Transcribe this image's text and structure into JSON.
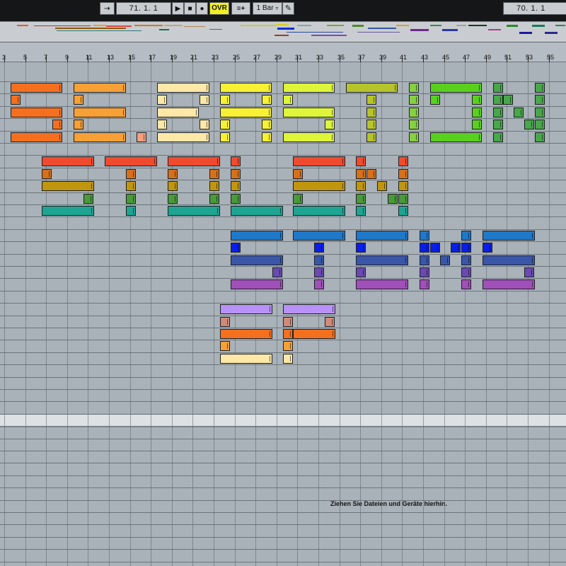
{
  "transport": {
    "follow_icon": "follow-arrow-icon",
    "position": "71.   1.   1",
    "play_icon": "play-icon",
    "stop_icon": "stop-icon",
    "record_icon": "record-icon",
    "ovr_label": "OVR",
    "draw_mode_icon": "draw-mode-icon",
    "quantize": "1 Bar",
    "pencil_icon": "pencil-icon",
    "position_right": "70.   1.   1"
  },
  "ruler": {
    "bars": [
      "3",
      "5",
      "7",
      "9",
      "11",
      "13",
      "15",
      "17",
      "19",
      "21",
      "23",
      "25",
      "27",
      "29",
      "31",
      "33",
      "35",
      "37",
      "39",
      "41",
      "43",
      "45",
      "47",
      "49",
      "51",
      "53",
      "55"
    ]
  },
  "arrangement": {
    "drop_hint": "Ziehen Sie Dateien und Geräte hierhin."
  },
  "colors": {
    "background": "#a9b1b9",
    "toolbar": "#141618",
    "ovr_button": "#f1ef24"
  }
}
